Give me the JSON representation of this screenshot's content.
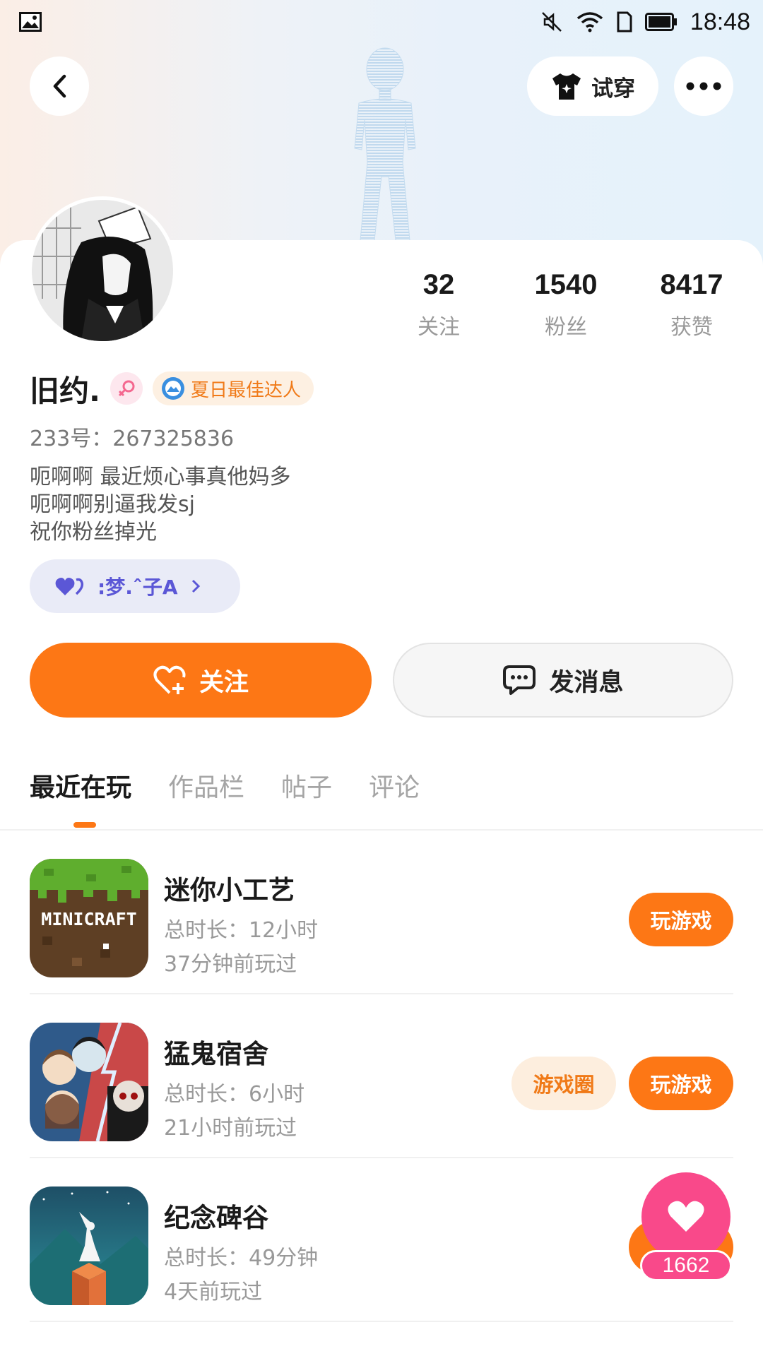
{
  "status_bar": {
    "time": "18:48"
  },
  "nav": {
    "try_on_label": "试穿"
  },
  "profile": {
    "name": "旧约.",
    "badge": "夏日最佳达人",
    "uid": "233号：267325836",
    "bio": [
      "呃啊啊 最近烦心事真他妈多",
      "呃啊啊别逼我发sj",
      "祝你粉丝掉光"
    ],
    "group_chip": ":梦.ˆ子A",
    "stats": [
      {
        "value": "32",
        "label": "关注"
      },
      {
        "value": "1540",
        "label": "粉丝"
      },
      {
        "value": "8417",
        "label": "获赞"
      }
    ]
  },
  "actions": {
    "follow_label": "关注",
    "message_label": "发消息"
  },
  "tabs": [
    "最近在玩",
    "作品栏",
    "帖子",
    "评论"
  ],
  "games": [
    {
      "name": "迷你小工艺",
      "icon_text": "MINICRAFT",
      "duration": "总时长：12小时",
      "last_played": "37分钟前玩过",
      "play_label": "玩游戏"
    },
    {
      "name": "猛鬼宿舍",
      "duration": "总时长：6小时",
      "last_played": "21小时前玩过",
      "circle_label": "游戏圈",
      "play_label": "玩游戏"
    },
    {
      "name": "纪念碑谷",
      "duration": "总时长：49分钟",
      "last_played": "4天前玩过"
    }
  ],
  "floating_like": {
    "count": "1662"
  },
  "colors": {
    "accent": "#fd7715",
    "like_pink": "#f9498a",
    "group_purple": "#5b57d6"
  }
}
